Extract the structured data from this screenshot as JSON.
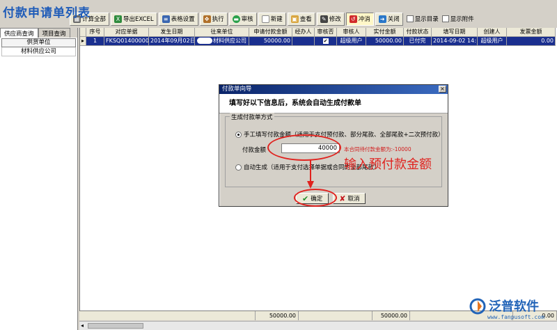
{
  "app": {
    "title": "付款申请单列表"
  },
  "toolbar": {
    "buttons": [
      {
        "label": "计算全部",
        "icon": "calculator-icon"
      },
      {
        "label": "导出EXCEL",
        "icon": "excel-icon"
      },
      {
        "label": "表格设置",
        "icon": "grid-settings-icon"
      },
      {
        "label": "执行",
        "icon": "run-icon"
      },
      {
        "label": "审核",
        "icon": "audit-icon"
      },
      {
        "label": "新建",
        "icon": "new-document-icon"
      },
      {
        "label": "查看",
        "icon": "view-icon"
      },
      {
        "label": "修改",
        "icon": "edit-icon"
      },
      {
        "label": "冲消",
        "icon": "reverse-icon"
      },
      {
        "label": "关闭",
        "icon": "close-door-icon"
      }
    ],
    "show_catalog_label": "显示目录",
    "show_attachment_label": "显示附件"
  },
  "left_panel": {
    "tabs": [
      "供应商查询",
      "项目查询"
    ],
    "tree_header": "供货单位",
    "items": [
      "材料供应公司"
    ]
  },
  "grid": {
    "columns": [
      "序号",
      "对应单据",
      "发生日期",
      "往来单位",
      "申请付款金额",
      "经办人",
      "审核否",
      "审核人",
      "实付金额",
      "付款状态",
      "填写日期",
      "创建人",
      "发票金额"
    ],
    "rows": [
      {
        "seq": "1",
        "doc": "FKSQ0140000016",
        "date": "2014年09月02日",
        "partner": "材料供应公司",
        "apply_amount": "50000.00",
        "handler": "",
        "audited": true,
        "auditor": "超级用户",
        "paid_amount": "50000.00",
        "status": "已付完",
        "fill_date": "2014-09-02 14:",
        "creator": "超级用户",
        "invoice_amount": "0.00"
      }
    ],
    "footer": {
      "apply_total": "50000.00",
      "paid_total": "50000.00",
      "invoice_total": "0.00"
    }
  },
  "dialog": {
    "title": "付款单向导",
    "heading": "填写好以下信息后，系统会自动生成付款单",
    "group_label": "生成付款单方式",
    "option_manual": "手工填写付款金额（适用于支付预付款、部分尾款、全部尾款+二次预付款）",
    "amount_label": "付款金额",
    "amount_value": "40000",
    "pending_note": "本合同待付款金额为:-10000",
    "option_auto": "自动生成（适用于支付选择单据或合同的全部尾款）",
    "ok_label": "确定",
    "cancel_label": "取消",
    "close_glyph": "×"
  },
  "annotation": {
    "text": "输入预付款金额"
  },
  "logo": {
    "name": "泛普软件",
    "url": "www.fanpusoft.com"
  },
  "colors": {
    "row_selected": "#1a2f8f",
    "title_blue": "#1e5bb8",
    "annotation_red": "#e0221e"
  }
}
